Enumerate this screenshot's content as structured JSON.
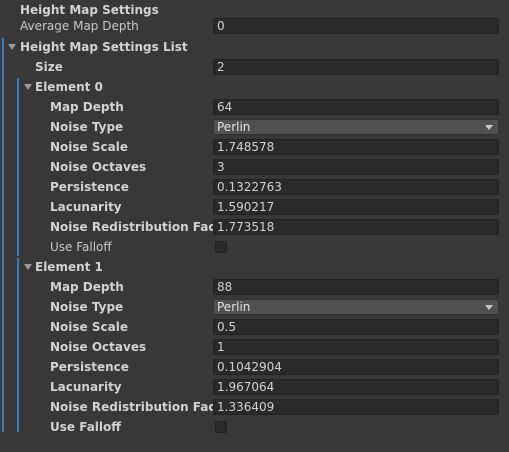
{
  "header": {
    "title": "Height Map Settings"
  },
  "average_map_depth": {
    "label": "Average Map Depth",
    "value": "0"
  },
  "list": {
    "title": "Height Map Settings List",
    "size_label": "Size",
    "size_value": "2"
  },
  "labels": {
    "map_depth": "Map Depth",
    "noise_type": "Noise Type",
    "noise_scale": "Noise Scale",
    "noise_octaves": "Noise Octaves",
    "persistence": "Persistence",
    "lacunarity": "Lacunarity",
    "noise_redistribution_factor": "Noise Redistribution Factor",
    "use_falloff": "Use Falloff"
  },
  "elements": [
    {
      "title": "Element 0",
      "map_depth": "64",
      "noise_type": "Perlin",
      "noise_scale": "1.748578",
      "noise_octaves": "3",
      "persistence": "0.1322763",
      "lacunarity": "1.590217",
      "noise_redistribution_factor": "1.773518",
      "use_falloff": false
    },
    {
      "title": "Element 1",
      "map_depth": "88",
      "noise_type": "Perlin",
      "noise_scale": "0.5",
      "noise_octaves": "1",
      "persistence": "0.1042904",
      "lacunarity": "1.967064",
      "noise_redistribution_factor": "1.336409",
      "use_falloff": false
    }
  ],
  "colors": {
    "background": "#383838",
    "field": "#2a2a2a",
    "dropdown": "#515151",
    "accent": "#3a79bb"
  }
}
